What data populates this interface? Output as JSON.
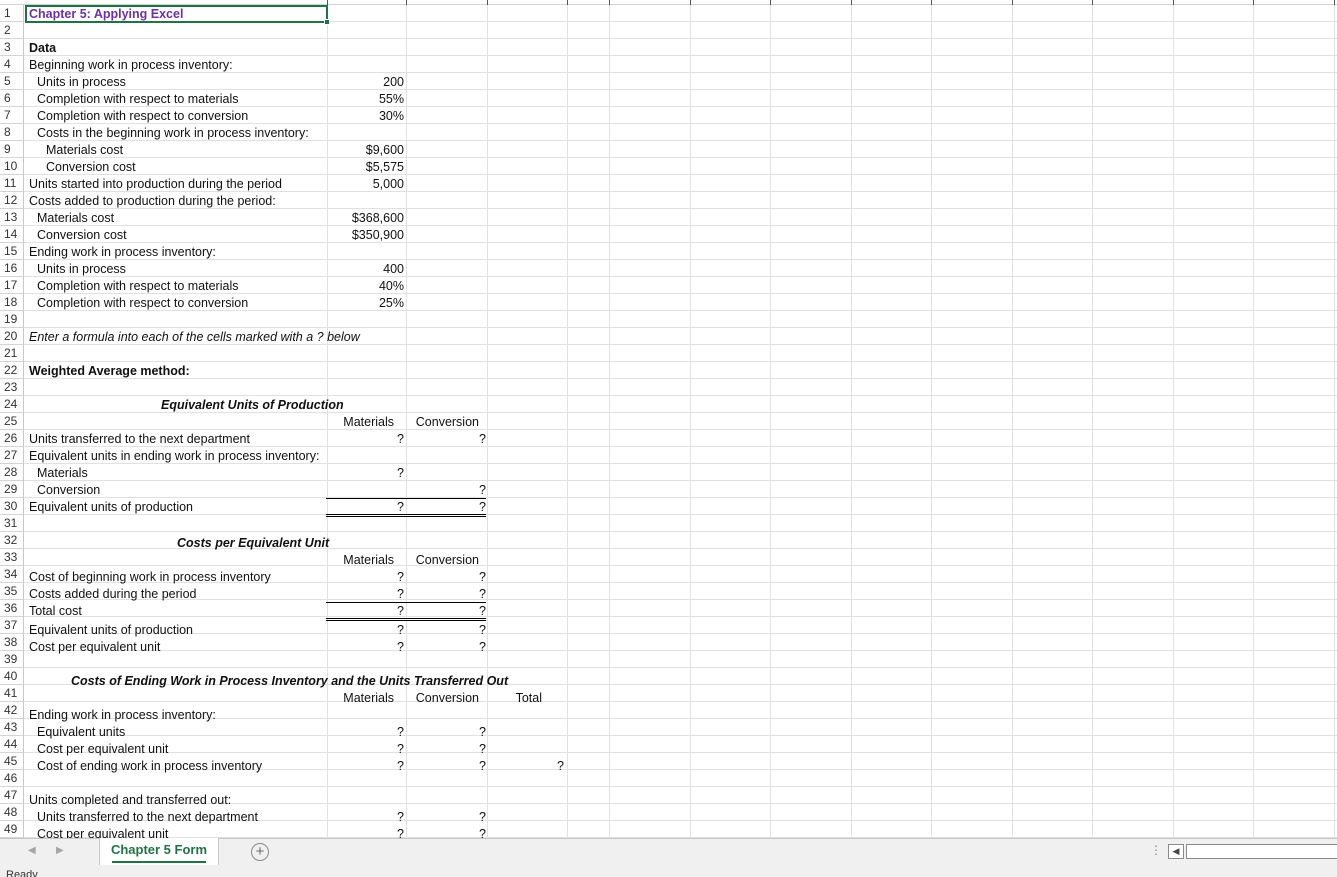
{
  "sheet": {
    "title": "Chapter 5: Applying Excel",
    "data_label": "Data",
    "beginning_wip": {
      "label": "Beginning work in process inventory:",
      "units_label": "Units in process",
      "units": "200",
      "mat_label": "Completion with respect to materials",
      "mat": "55%",
      "conv_label": "Completion with respect to conversion",
      "conv": "30%",
      "costs_label": "Costs in the beginning work in process inventory:",
      "mat_cost_label": "Materials cost",
      "mat_cost": "$9,600",
      "conv_cost_label": "Conversion cost",
      "conv_cost": "$5,575"
    },
    "units_started_label": "Units started into production during the period",
    "units_started": "5,000",
    "costs_added": {
      "label": "Costs added to production during the period:",
      "mat_label": "Materials cost",
      "mat": "$368,600",
      "conv_label": "Conversion cost",
      "conv": "$350,900"
    },
    "ending_wip": {
      "label": "Ending work in process inventory:",
      "units_label": "Units in process",
      "units": "400",
      "mat_label": "Completion with respect to materials",
      "mat": "40%",
      "conv_label": "Completion with respect to conversion",
      "conv": "25%"
    },
    "instruction": "Enter a formula into each of the cells marked with a ? below",
    "method_label": "Weighted Average method:",
    "eq_units": {
      "heading": "Equivalent Units of Production",
      "col_materials": "Materials",
      "col_conversion": "Conversion",
      "transferred_label": "Units transferred to the next department",
      "ending_label": "Equivalent units in ending work in process inventory:",
      "materials_label": "Materials",
      "conversion_label": "Conversion",
      "total_label": "Equivalent units of production"
    },
    "cost_per_unit": {
      "heading": "Costs per Equivalent Unit",
      "col_materials": "Materials",
      "col_conversion": "Conversion",
      "beginning_label": "Cost of beginning work in process inventory",
      "added_label": "Costs added during the period",
      "total_label": "Total cost",
      "eq_label": "Equivalent units of production",
      "cpu_label": "Cost per equivalent unit"
    },
    "costs_ending": {
      "heading": "Costs of Ending Work in Process Inventory and the Units Transferred Out",
      "col_materials": "Materials",
      "col_conversion": "Conversion",
      "col_total": "Total",
      "ending_label": "Ending work in process inventory:",
      "eq_units_label": "Equivalent units",
      "cpu_label": "Cost per equivalent unit",
      "cost_label": "Cost of ending work in process inventory",
      "completed_label": "Units completed and transferred out:",
      "transferred_label": "Units transferred to the next department",
      "cpu2_label": "Cost per equivalent unit"
    },
    "placeholder": "?"
  },
  "row_numbers": [
    "1",
    "2",
    "3",
    "4",
    "5",
    "6",
    "7",
    "8",
    "9",
    "10",
    "11",
    "12",
    "13",
    "14",
    "15",
    "16",
    "17",
    "18",
    "19",
    "20",
    "21",
    "22",
    "23",
    "24",
    "25",
    "26",
    "27",
    "28",
    "29",
    "30",
    "31",
    "32",
    "33",
    "34",
    "35",
    "36",
    "37",
    "38",
    "39",
    "40",
    "41",
    "42",
    "43",
    "44",
    "45",
    "46",
    "47",
    "48",
    "49"
  ],
  "tabs": {
    "active": "Chapter 5 Form"
  },
  "status": {
    "text": "Ready"
  },
  "colors": {
    "accent": "#217346",
    "title": "#7030a0"
  }
}
